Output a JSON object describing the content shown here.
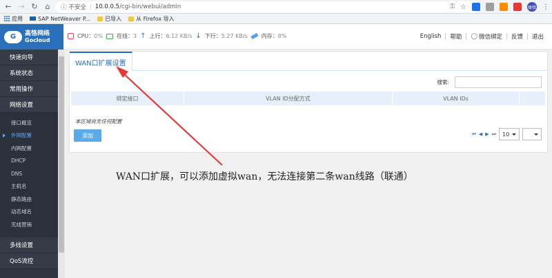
{
  "browser": {
    "security_label": "不安全",
    "url_host": "10.0.0.5",
    "url_path": "/cgi-bin/webui/admin",
    "bookmarks": [
      {
        "label": "应用",
        "icon": "apps-grid-icon"
      },
      {
        "label": "SAP NetWeaver P...",
        "icon": "sap-icon"
      },
      {
        "label": "已导入",
        "icon": "folder-icon"
      },
      {
        "label": "从 Firefox 导入",
        "icon": "folder-icon"
      }
    ],
    "avatar_text": "体验"
  },
  "header": {
    "logo_cn": "高恪网络",
    "logo_en": "Gocloud",
    "cpu_label": "CPU：",
    "cpu_value": "0%",
    "online_label": "在线：",
    "online_value": "3",
    "up_label": "上行：",
    "up_value": "6.12 KB/s",
    "down_label": "下行：",
    "down_value": "5.27 KB/s",
    "mem_label": "内存：",
    "mem_value": "8%",
    "links": [
      "English",
      "帮助",
      "微信绑定",
      "反馈",
      "退出"
    ]
  },
  "sidebar": {
    "groups_top": [
      "快速向导",
      "系统状态",
      "常用操作",
      "网络设置"
    ],
    "sub_items": [
      "接口概览",
      "外网配置",
      "内网配置",
      "DHCP",
      "DNS",
      "主机名",
      "静态路由",
      "动态域名",
      "无线营销"
    ],
    "active_sub_index": 1,
    "groups_bottom": [
      "多线设置",
      "QoS流控"
    ]
  },
  "panel": {
    "tab_label": "WAN口扩展设置",
    "search_label": "搜索:",
    "search_value": "",
    "columns": [
      "绑定接口",
      "VLAN ID分配方式",
      "VLAN IDs",
      ""
    ],
    "empty_message": "本区域尚无任何配置",
    "add_label": "添加",
    "page_size": "10",
    "page_select": ""
  },
  "annotation_text": "WAN口扩展，可以添加虚拟wan，无法连接第二条wan线路（联通）",
  "colors": {
    "brand": "#2a6fb9",
    "sidebar_bg": "#2f3640",
    "arrow": "#e53935",
    "add_button": "#5aaae8"
  }
}
